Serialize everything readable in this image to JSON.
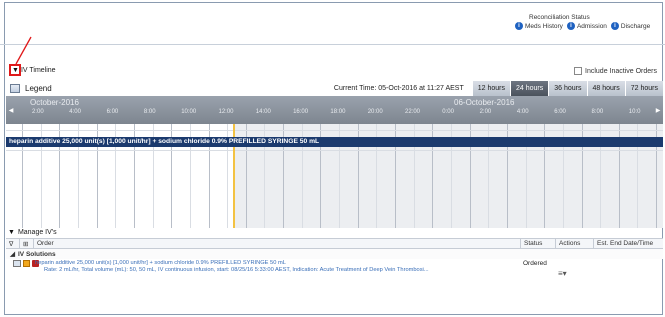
{
  "reconciliation": {
    "title": "Reconciliation Status",
    "items": [
      "Meds History",
      "Admission",
      "Discharge"
    ]
  },
  "iv_timeline": {
    "title": "IV Timeline",
    "include_inactive_label": "Include Inactive Orders",
    "legend_label": "Legend",
    "current_time": "Current Time: 05-Oct-2016 at 11:27 AEST",
    "ranges": [
      "12 hours",
      "24 hours",
      "36 hours",
      "48 hours",
      "72 hours"
    ],
    "active_range": "24 hours",
    "axis": {
      "month_left": "October-2016",
      "month_right": "06-October-2016",
      "ticks": [
        "2:00",
        "4:00",
        "6:00",
        "8:00",
        "10:00",
        "12:00",
        "14:00",
        "16:00",
        "18:00",
        "20:00",
        "22:00",
        "0:00",
        "2:00",
        "4:00",
        "6:00",
        "8:00",
        "10:0"
      ]
    },
    "infusion_bar": "heparin additive 25,000 unit(s) [1,000 unit/hr] + sodium chloride 0.9% PREFILLED SYRINGE 50 mL"
  },
  "manage": {
    "title": "Manage IV's",
    "columns": {
      "order": "Order",
      "status": "Status",
      "actions": "Actions",
      "end": "Est. End Date/Time"
    },
    "group": "IV Solutions",
    "rows": [
      {
        "line1": "heparin additive 25,000 unit(s) [1,000 unit/hr] + sodium chloride 0.9% PREFILLED SYRINGE 50 mL",
        "line2": "Rate: 2 mL/hr, Total volume (mL): 50, 50 mL, IV continuous infusion, start: 08/25/16 5:33:00 AEST, Indication: Acute Treatment of Deep Vein Thrombosi...",
        "status": "Ordered",
        "actions_icon": "≡▾"
      }
    ]
  },
  "colors": {
    "header_bar": "#1b3a6e",
    "now_marker": "#f3c242",
    "annotation": "#e0191a",
    "active_tab": "#4b525c"
  }
}
